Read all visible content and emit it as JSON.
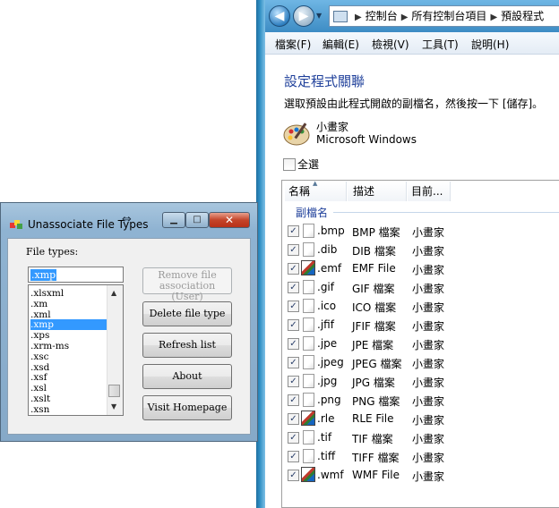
{
  "control_panel": {
    "breadcrumb": [
      "控制台",
      "所有控制台項目",
      "預設程式"
    ],
    "menu": [
      "檔案(F)",
      "編輯(E)",
      "檢視(V)",
      "工具(T)",
      "說明(H)"
    ],
    "title": "設定程式關聯",
    "description": "選取預設由此程式開啟的副檔名，然後按一下 [儲存]。",
    "program_name": "小畫家",
    "program_publisher": "Microsoft Windows",
    "select_all_label": "全選",
    "columns": [
      "名稱",
      "描述",
      "目前..."
    ],
    "group_label": "副檔名",
    "check_glyph": "✓",
    "rows": [
      {
        "ext": ".bmp",
        "desc": "BMP 檔案",
        "current": "小畫家",
        "icon": "doc"
      },
      {
        "ext": ".dib",
        "desc": "DIB 檔案",
        "current": "小畫家",
        "icon": "doc"
      },
      {
        "ext": ".emf",
        "desc": "EMF File",
        "current": "小畫家",
        "icon": "special"
      },
      {
        "ext": ".gif",
        "desc": "GIF 檔案",
        "current": "小畫家",
        "icon": "doc"
      },
      {
        "ext": ".ico",
        "desc": "ICO 檔案",
        "current": "小畫家",
        "icon": "doc"
      },
      {
        "ext": ".jfif",
        "desc": "JFIF 檔案",
        "current": "小畫家",
        "icon": "doc"
      },
      {
        "ext": ".jpe",
        "desc": "JPE 檔案",
        "current": "小畫家",
        "icon": "doc"
      },
      {
        "ext": ".jpeg",
        "desc": "JPEG 檔案",
        "current": "小畫家",
        "icon": "doc"
      },
      {
        "ext": ".jpg",
        "desc": "JPG 檔案",
        "current": "小畫家",
        "icon": "doc"
      },
      {
        "ext": ".png",
        "desc": "PNG 檔案",
        "current": "小畫家",
        "icon": "doc"
      },
      {
        "ext": ".rle",
        "desc": "RLE File",
        "current": "小畫家",
        "icon": "special"
      },
      {
        "ext": ".tif",
        "desc": "TIF 檔案",
        "current": "小畫家",
        "icon": "doc"
      },
      {
        "ext": ".tiff",
        "desc": "TIFF 檔案",
        "current": "小畫家",
        "icon": "doc"
      },
      {
        "ext": ".wmf",
        "desc": "WMF File",
        "current": "小畫家",
        "icon": "special"
      }
    ]
  },
  "dialog": {
    "title": "Unassociate File Types",
    "close_glyph": "✕",
    "min_glyph": "▁",
    "max_glyph": "□",
    "file_types_label": "File types:",
    "input_value": ".xmp",
    "list_items": [
      ".xlsxml",
      ".xm",
      ".xml",
      ".xmp",
      ".xps",
      ".xrm-ms",
      ".xsc",
      ".xsd",
      ".xsf",
      ".xsl",
      ".xslt",
      ".xsn"
    ],
    "selected_item": ".xmp",
    "buttons": {
      "remove_line1": "Remove file",
      "remove_line2": "association (User)",
      "delete": "Delete file type",
      "refresh": "Refresh list",
      "about": "About",
      "homepage": "Visit Homepage"
    }
  },
  "colors": {
    "selection": "#3399ff",
    "title_blue": "#1e3f9a",
    "close_red": "#c4442a"
  }
}
